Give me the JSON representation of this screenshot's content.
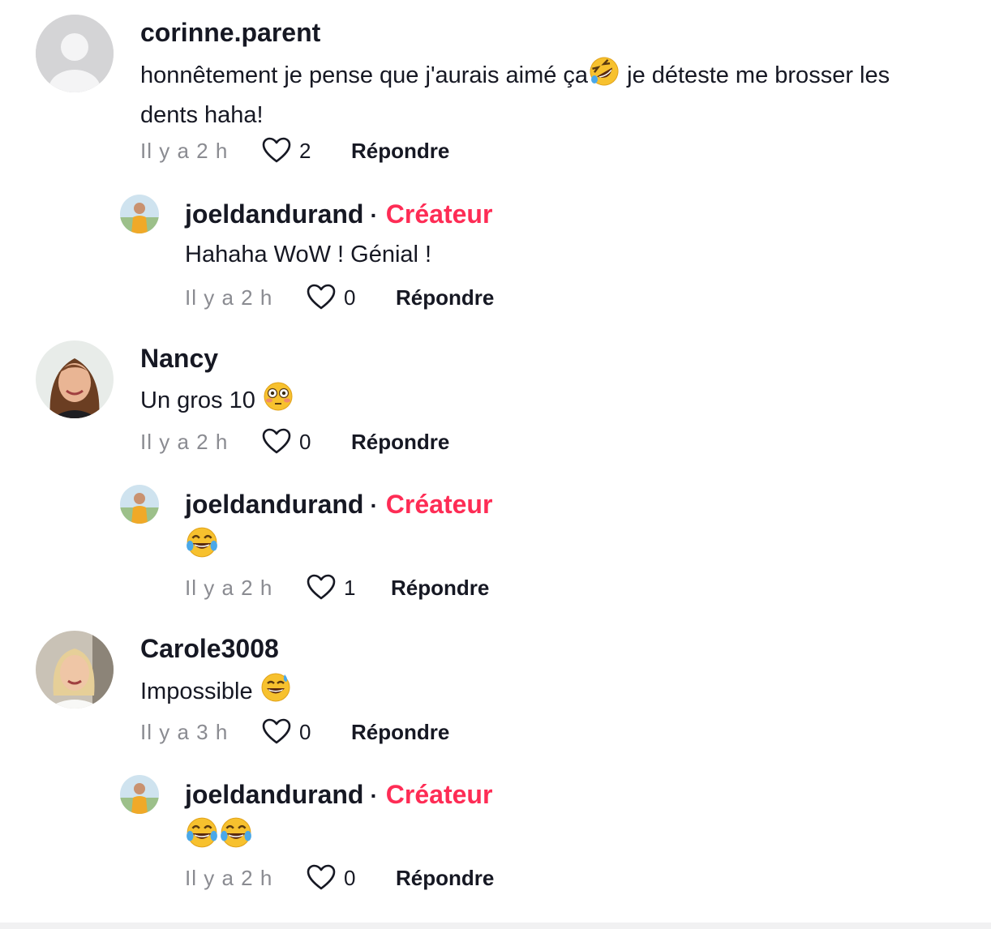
{
  "comments": [
    {
      "username": "corinne.parent",
      "text_part1": "honnêtement je pense que j'aurais aimé ça",
      "text_part2": " je déteste me brosser les",
      "text_line2": "dents haha!",
      "emoji": "rolling-on-floor-laughing-emoji",
      "time": "Il y a 2 h",
      "likes": "2",
      "reply_label": "Répondre"
    },
    {
      "username": "joeldandurand",
      "creator_label": "Créateur",
      "text": "Hahaha WoW ! Génial !",
      "time": "Il y a 2 h",
      "likes": "0",
      "reply_label": "Répondre"
    },
    {
      "username": "Nancy",
      "text": "Un gros 10 ",
      "emoji": "flushed-face-emoji",
      "time": "Il y a 2 h",
      "likes": "0",
      "reply_label": "Répondre"
    },
    {
      "username": "joeldandurand",
      "creator_label": "Créateur",
      "emoji": "tears-of-joy-emoji",
      "time": "Il y a 2 h",
      "likes": "1",
      "reply_label": "Répondre"
    },
    {
      "username": "Carole3008",
      "text": "Impossible ",
      "emoji": "grinning-sweat-emoji",
      "time": "Il y a 3 h",
      "likes": "0",
      "reply_label": "Répondre"
    },
    {
      "username": "joeldandurand",
      "creator_label": "Créateur",
      "emoji": "tears-of-joy-emoji-x2",
      "time": "Il y a 2 h",
      "likes": "0",
      "reply_label": "Répondre"
    }
  ],
  "separator": "·",
  "colors": {
    "creator": "#fe2c55",
    "meta": "#8a8b91",
    "text": "#161823"
  }
}
